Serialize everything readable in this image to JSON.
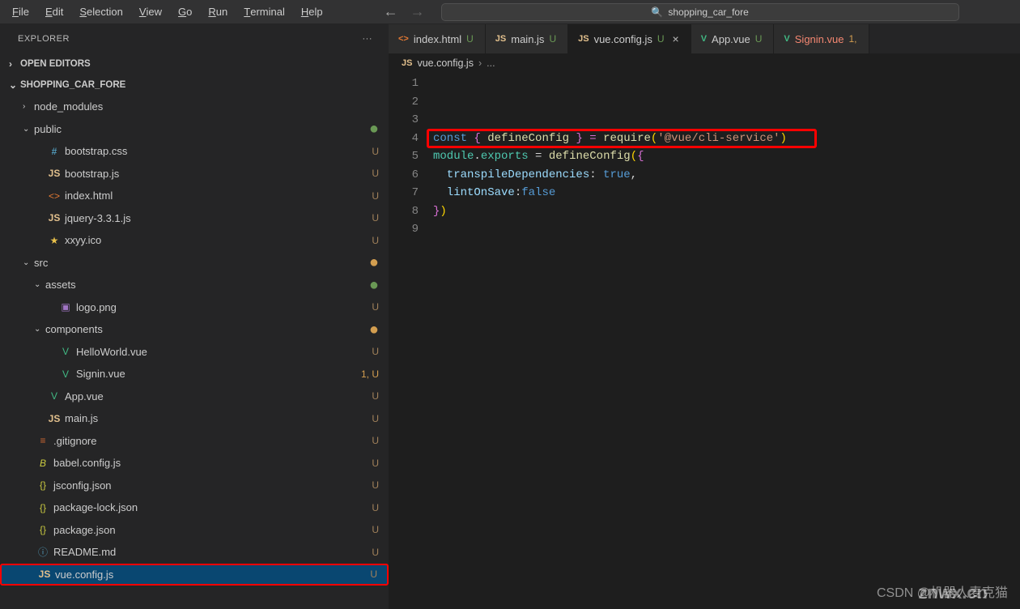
{
  "menu": {
    "file": "File",
    "edit": "Edit",
    "selection": "Selection",
    "view": "View",
    "go": "Go",
    "run": "Run",
    "terminal": "Terminal",
    "help": "Help"
  },
  "search": {
    "text": "shopping_car_fore"
  },
  "sidebar": {
    "title": "EXPLORER",
    "openEditors": "OPEN EDITORS",
    "project": "SHOPPING_CAR_FORE",
    "files": [
      {
        "name": "node_modules",
        "indent": 28,
        "chev": "›",
        "icn": "",
        "cls": "",
        "status": ""
      },
      {
        "name": "public",
        "indent": 28,
        "chev": "⌄",
        "icn": "",
        "cls": "",
        "status": "●",
        "stcls": "dot-u"
      },
      {
        "name": "bootstrap.css",
        "indent": 42,
        "chev": "",
        "icn": "#",
        "cls": "ic-hash",
        "status": "U"
      },
      {
        "name": "bootstrap.js",
        "indent": 42,
        "chev": "",
        "icn": "JS",
        "cls": "ic-js",
        "status": "U"
      },
      {
        "name": "index.html",
        "indent": 42,
        "chev": "",
        "icn": "<>",
        "cls": "ic-html",
        "status": "U"
      },
      {
        "name": "jquery-3.3.1.js",
        "indent": 42,
        "chev": "",
        "icn": "JS",
        "cls": "ic-js",
        "status": "U"
      },
      {
        "name": "xxyy.ico",
        "indent": 42,
        "chev": "",
        "icn": "★",
        "cls": "ic-star",
        "status": "U"
      },
      {
        "name": "src",
        "indent": 28,
        "chev": "⌄",
        "icn": "",
        "cls": "",
        "status": "●",
        "stcls": "dot-m"
      },
      {
        "name": "assets",
        "indent": 42,
        "chev": "⌄",
        "icn": "",
        "cls": "",
        "status": "●",
        "stcls": "dot-u"
      },
      {
        "name": "logo.png",
        "indent": 56,
        "chev": "",
        "icn": "▣",
        "cls": "ic-png",
        "status": "U"
      },
      {
        "name": "components",
        "indent": 42,
        "chev": "⌄",
        "icn": "",
        "cls": "",
        "status": "●",
        "stcls": "dot-m"
      },
      {
        "name": "HelloWorld.vue",
        "indent": 56,
        "chev": "",
        "icn": "V",
        "cls": "ic-vue",
        "status": "U"
      },
      {
        "name": "Signin.vue",
        "indent": 56,
        "chev": "",
        "icn": "V",
        "cls": "ic-vue",
        "status": "1, U",
        "stcls": "mod"
      },
      {
        "name": "App.vue",
        "indent": 42,
        "chev": "",
        "icn": "V",
        "cls": "ic-vue",
        "status": "U"
      },
      {
        "name": "main.js",
        "indent": 42,
        "chev": "",
        "icn": "JS",
        "cls": "ic-js",
        "status": "U"
      },
      {
        "name": ".gitignore",
        "indent": 28,
        "chev": "",
        "icn": "≡",
        "cls": "ic-git",
        "status": "U"
      },
      {
        "name": "babel.config.js",
        "indent": 28,
        "chev": "",
        "icn": "B",
        "cls": "ic-babel",
        "status": "U"
      },
      {
        "name": "jsconfig.json",
        "indent": 28,
        "chev": "",
        "icn": "{}",
        "cls": "ic-json",
        "status": "U"
      },
      {
        "name": "package-lock.json",
        "indent": 28,
        "chev": "",
        "icn": "{}",
        "cls": "ic-json",
        "status": "U"
      },
      {
        "name": "package.json",
        "indent": 28,
        "chev": "",
        "icn": "{}",
        "cls": "ic-json",
        "status": "U"
      },
      {
        "name": "README.md",
        "indent": 28,
        "chev": "",
        "icn": "ⓘ",
        "cls": "ic-info",
        "status": "U"
      },
      {
        "name": "vue.config.js",
        "indent": 28,
        "chev": "",
        "icn": "JS",
        "cls": "ic-js",
        "status": "U",
        "active": true
      }
    ]
  },
  "tabs": [
    {
      "icon": "<>",
      "cls": "ic-html",
      "name": "index.html",
      "badge": "U",
      "bcls": "tm"
    },
    {
      "icon": "JS",
      "cls": "ic-js",
      "name": "main.js",
      "badge": "U",
      "bcls": "tm"
    },
    {
      "icon": "JS",
      "cls": "ic-js",
      "name": "vue.config.js",
      "badge": "U",
      "bcls": "tm",
      "active": true,
      "close": "×"
    },
    {
      "icon": "V",
      "cls": "ic-vue",
      "name": "App.vue",
      "badge": "U",
      "bcls": "tm"
    },
    {
      "icon": "V",
      "cls": "ic-vue sty-err",
      "name": "Signin.vue",
      "badge": "1,",
      "bcls": "mod",
      "err": true
    }
  ],
  "breadcrumb": {
    "file": "vue.config.js",
    "sep": "›",
    "rest": "..."
  },
  "code": {
    "lines": [
      "1",
      "2",
      "3",
      "4",
      "5",
      "6",
      "7",
      "8",
      "9"
    ],
    "l1a": "const",
    "l1b": " { ",
    "l1c": "defineConfig",
    "l1d": " } = ",
    "l1e": "require",
    "l1f": "(",
    "l1g": "'@vue/cli-service'",
    "l1h": ")",
    "l2a": "module",
    "l2b": ".",
    "l2c": "exports",
    "l2d": " = ",
    "l2e": "defineConfig",
    "l2f": "(",
    "l2g": "{",
    "l3a": "  transpileDependencies",
    "l3b": ": ",
    "l3c": "true",
    "l3d": ",",
    "l4a": "  lintOnSave",
    "l4b": ":",
    "l4c": "false",
    "l5a": "}",
    "l5b": ")",
    "l6": ""
  },
  "watermark": "CSDN @机器人麦克猫",
  "watermark2": "znwx.cn"
}
